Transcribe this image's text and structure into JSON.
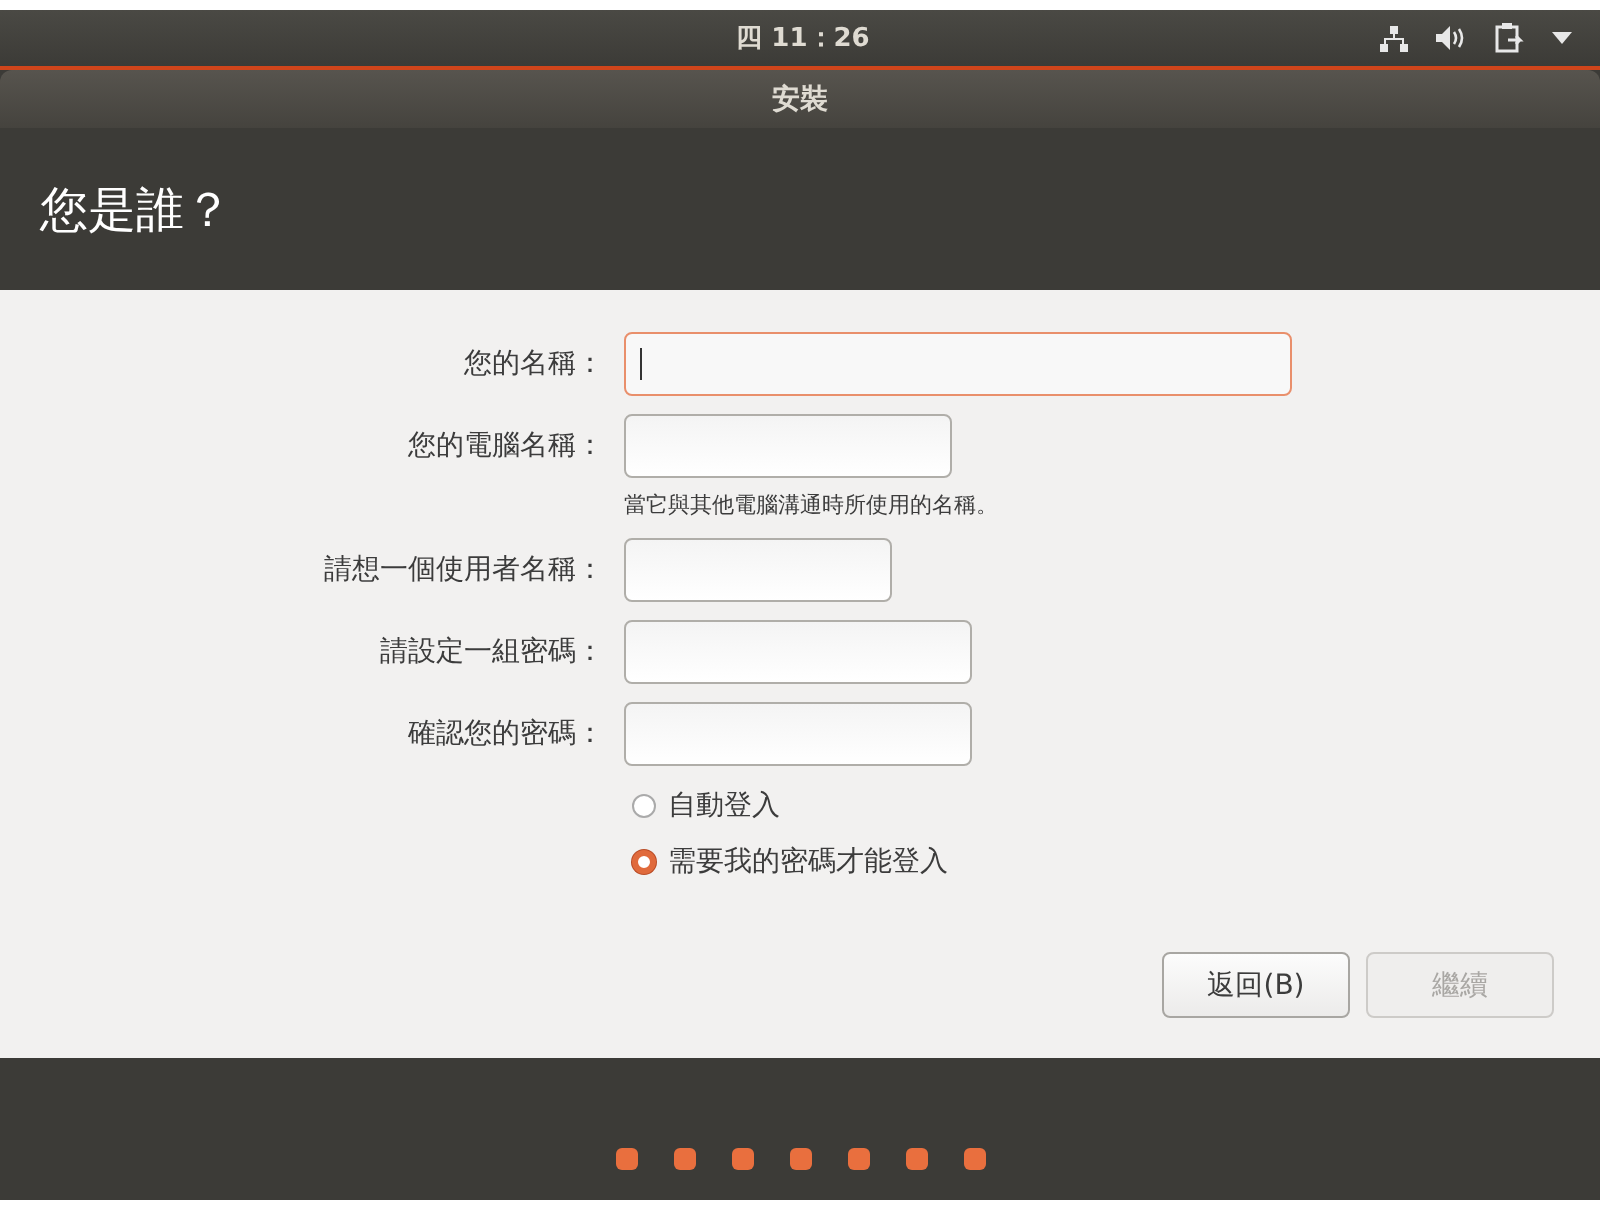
{
  "top_bar": {
    "clock": "四 11：26"
  },
  "window": {
    "title": "安裝"
  },
  "heading": "您是誰？",
  "fields": [
    {
      "label": "您的名稱：",
      "focused": true
    },
    {
      "label": "您的電腦名稱：",
      "focused": false,
      "hint": "當它與其他電腦溝通時所使用的名稱。"
    },
    {
      "label": "請想一個使用者名稱：",
      "focused": false
    },
    {
      "label": "請設定一組密碼：",
      "focused": false
    },
    {
      "label": "確認您的密碼：",
      "focused": false
    }
  ],
  "login_options": [
    {
      "label": "自動登入",
      "selected": false
    },
    {
      "label": "需要我的密碼才能登入",
      "selected": true
    }
  ],
  "buttons": [
    {
      "label": "返回(B)",
      "disabled": false
    },
    {
      "label": "繼續",
      "disabled": true
    }
  ],
  "steps": [
    {
      "done": true
    },
    {
      "done": true
    },
    {
      "done": true
    },
    {
      "done": true
    },
    {
      "done": true
    },
    {
      "done": true
    },
    {
      "done": true
    }
  ]
}
